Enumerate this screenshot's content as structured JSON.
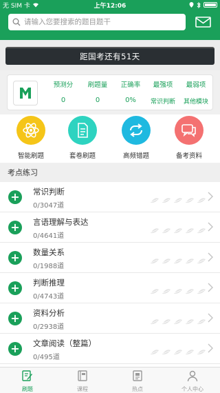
{
  "status_bar": {
    "carrier": "无 SIM 卡",
    "time": "上午12:06"
  },
  "search": {
    "placeholder": "请输入您要搜索的题目题干"
  },
  "banner": {
    "text": "距国考还有51天"
  },
  "stats": [
    {
      "label": "预测分",
      "value": "0"
    },
    {
      "label": "刷题量",
      "value": "0"
    },
    {
      "label": "正确率",
      "value": "0%"
    },
    {
      "label": "最强项",
      "value": "常识判断"
    },
    {
      "label": "最弱项",
      "value": "其他模块"
    }
  ],
  "quick_actions": [
    {
      "label": "智能刷题",
      "icon": "atom-icon",
      "color": "#f5c518"
    },
    {
      "label": "套卷刷题",
      "icon": "document-icon",
      "color": "#2ed3c0"
    },
    {
      "label": "高频错题",
      "icon": "repeat-icon",
      "color": "#1fb9e0"
    },
    {
      "label": "备考资料",
      "icon": "chat-icon",
      "color": "#f47171"
    }
  ],
  "section": {
    "title": "考点练习"
  },
  "practice_items": [
    {
      "title": "常识判断",
      "count": "0/3047道"
    },
    {
      "title": "言语理解与表达",
      "count": "0/4641道"
    },
    {
      "title": "数量关系",
      "count": "0/1988道"
    },
    {
      "title": "判断推理",
      "count": "0/4743道"
    },
    {
      "title": "资料分析",
      "count": "0/2938道"
    },
    {
      "title": "文章阅读（整篇）",
      "count": "0/495道"
    }
  ],
  "tabs": [
    {
      "label": "刷题",
      "icon": "pencil-note-icon",
      "active": true
    },
    {
      "label": "课程",
      "icon": "book-icon",
      "active": false
    },
    {
      "label": "热点",
      "icon": "news-icon",
      "active": false
    },
    {
      "label": "个人中心",
      "icon": "user-icon",
      "active": false
    }
  ],
  "colors": {
    "brand": "#1aa05a",
    "banner_bg": "#2a2f33"
  }
}
